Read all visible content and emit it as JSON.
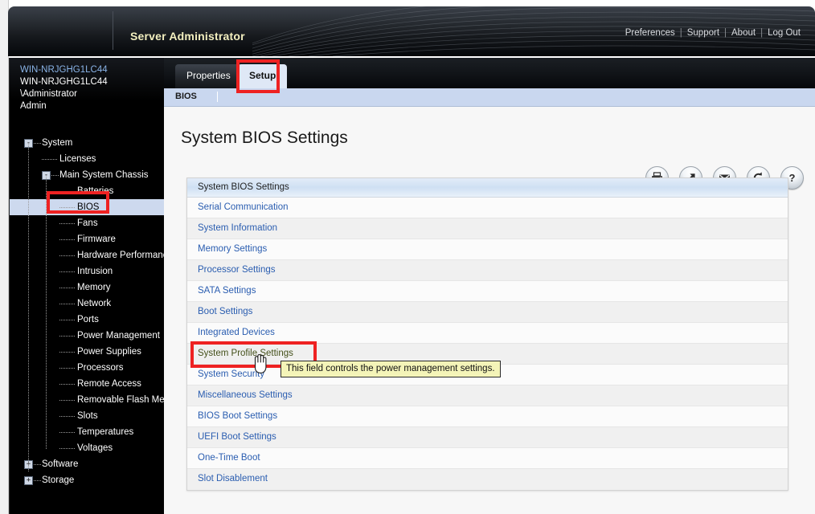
{
  "banner": {
    "title": "Server Administrator",
    "links": [
      "Preferences",
      "Support",
      "About",
      "Log Out"
    ],
    "separator": "|"
  },
  "sidebar": {
    "info": {
      "hostname_link": "WIN-NRJGHG1LC44",
      "hostname": "WIN-NRJGHG1LC44",
      "user": "\\Administrator",
      "role": "Admin"
    },
    "tree": [
      {
        "label": "System",
        "depth": 0,
        "toggle": "-",
        "selected": false
      },
      {
        "label": "Licenses",
        "depth": 1,
        "toggle": null,
        "selected": false
      },
      {
        "label": "Main System Chassis",
        "depth": 1,
        "toggle": "-",
        "selected": false
      },
      {
        "label": "Batteries",
        "depth": 2,
        "toggle": null,
        "selected": false
      },
      {
        "label": "BIOS",
        "depth": 2,
        "toggle": null,
        "selected": true
      },
      {
        "label": "Fans",
        "depth": 2,
        "toggle": null,
        "selected": false
      },
      {
        "label": "Firmware",
        "depth": 2,
        "toggle": null,
        "selected": false
      },
      {
        "label": "Hardware Performance",
        "depth": 2,
        "toggle": null,
        "selected": false
      },
      {
        "label": "Intrusion",
        "depth": 2,
        "toggle": null,
        "selected": false
      },
      {
        "label": "Memory",
        "depth": 2,
        "toggle": null,
        "selected": false
      },
      {
        "label": "Network",
        "depth": 2,
        "toggle": null,
        "selected": false
      },
      {
        "label": "Ports",
        "depth": 2,
        "toggle": null,
        "selected": false
      },
      {
        "label": "Power Management",
        "depth": 2,
        "toggle": null,
        "selected": false
      },
      {
        "label": "Power Supplies",
        "depth": 2,
        "toggle": null,
        "selected": false
      },
      {
        "label": "Processors",
        "depth": 2,
        "toggle": null,
        "selected": false
      },
      {
        "label": "Remote Access",
        "depth": 2,
        "toggle": null,
        "selected": false
      },
      {
        "label": "Removable Flash Media",
        "depth": 2,
        "toggle": null,
        "selected": false
      },
      {
        "label": "Slots",
        "depth": 2,
        "toggle": null,
        "selected": false
      },
      {
        "label": "Temperatures",
        "depth": 2,
        "toggle": null,
        "selected": false
      },
      {
        "label": "Voltages",
        "depth": 2,
        "toggle": null,
        "selected": false
      },
      {
        "label": "Software",
        "depth": 0,
        "toggle": "+",
        "selected": false
      },
      {
        "label": "Storage",
        "depth": 0,
        "toggle": "+",
        "selected": false
      }
    ]
  },
  "tabs": [
    {
      "label": "Properties",
      "active": false
    },
    {
      "label": "Setup",
      "active": true
    }
  ],
  "subtab": {
    "label": "BIOS"
  },
  "page": {
    "title": "System BIOS Settings"
  },
  "toolbar": [
    {
      "name": "print-icon",
      "label": "Print"
    },
    {
      "name": "export-icon",
      "label": "Export"
    },
    {
      "name": "email-icon",
      "label": "Email"
    },
    {
      "name": "refresh-icon",
      "label": "Refresh"
    },
    {
      "name": "help-icon",
      "label": "Help"
    }
  ],
  "settings_table": {
    "header": "System BIOS Settings",
    "rows": [
      {
        "label": "Serial Communication",
        "hovered": false
      },
      {
        "label": "System Information",
        "hovered": false
      },
      {
        "label": "Memory Settings",
        "hovered": false
      },
      {
        "label": "Processor Settings",
        "hovered": false
      },
      {
        "label": "SATA Settings",
        "hovered": false
      },
      {
        "label": "Boot Settings",
        "hovered": false
      },
      {
        "label": "Integrated Devices",
        "hovered": false
      },
      {
        "label": "System Profile Settings",
        "hovered": true
      },
      {
        "label": "System Security",
        "hovered": false
      },
      {
        "label": "Miscellaneous Settings",
        "hovered": false
      },
      {
        "label": "BIOS Boot Settings",
        "hovered": false
      },
      {
        "label": "UEFI Boot Settings",
        "hovered": false
      },
      {
        "label": "One-Time Boot",
        "hovered": false
      },
      {
        "label": "Slot Disablement",
        "hovered": false
      }
    ]
  },
  "tooltip": {
    "text": "This field controls the power management settings."
  },
  "colors": {
    "accent_link": "#2a5db0",
    "annotation": "#ee2222",
    "tooltip_bg": "#f4f4b8",
    "selection": "#cdd9ee",
    "banner_title": "#f3efbf"
  }
}
